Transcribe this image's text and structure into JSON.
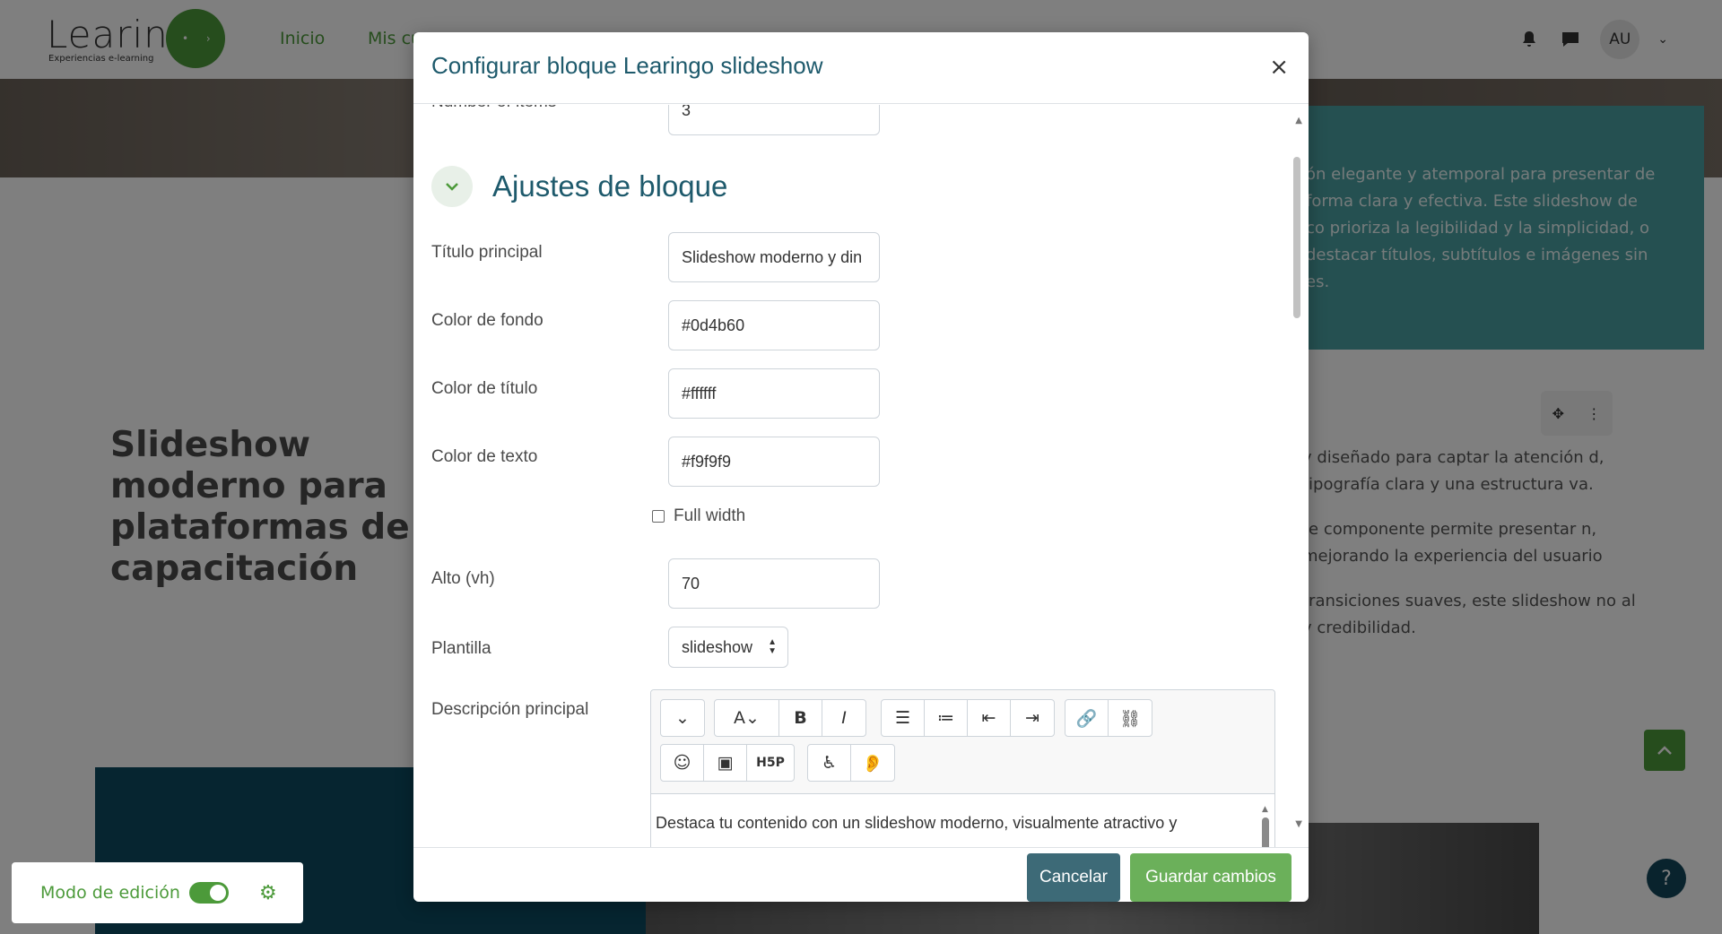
{
  "brand": {
    "logo_word": "Learin",
    "logo_sub": "Experiencias e-learning",
    "color": "#4c9a3a"
  },
  "nav": {
    "links": [
      "Inicio",
      "Mis cu"
    ],
    "avatar": "AU"
  },
  "background": {
    "teal_text": "ón elegante y atemporal para presentar de forma clara y efectiva. Este slideshow de co prioriza la legibilidad y la simplicidad, o destacar títulos, subtítulos e imágenes sin es.",
    "big_title": "Slideshow moderno para plataformas de capacitación",
    "right_paragraphs": [
      "y diseñado para captar la atención d, tipografía clara y una estructura va.",
      "te componente permite presentar n, mejorando la experiencia del usuario",
      "transiciones suaves, este slideshow no al y credibilidad."
    ],
    "help": "?"
  },
  "edit_mode": {
    "label": "Modo de edición",
    "enabled": true
  },
  "modal": {
    "title": "Configurar bloque Learingo slideshow",
    "close": "×",
    "partial_label": "Number of items",
    "partial_value": "3",
    "section_title": "Ajustes de bloque",
    "fields": {
      "titulo_label": "Título principal",
      "titulo_value": "Slideshow moderno y din",
      "fondo_label": "Color de fondo",
      "fondo_value": "#0d4b60",
      "titulo_color_label": "Color de título",
      "titulo_color_value": "#ffffff",
      "texto_label": "Color de texto",
      "texto_value": "#f9f9f9",
      "fullwidth_label": "Full width",
      "alto_label": "Alto (vh)",
      "alto_value": "70",
      "plantilla_label": "Plantilla",
      "plantilla_value": "slideshow",
      "descripcion_label": "Descripción principal",
      "descripcion_text": "Destaca tu contenido con un slideshow moderno, visualmente atractivo y"
    },
    "cancel": "Cancelar",
    "save": "Guardar cambios"
  },
  "colors": {
    "primary_teal": "#1e5a6c",
    "accent_green": "#4c9a3a",
    "cancel_btn": "#3d6a77",
    "save_btn": "#6bb05a"
  }
}
